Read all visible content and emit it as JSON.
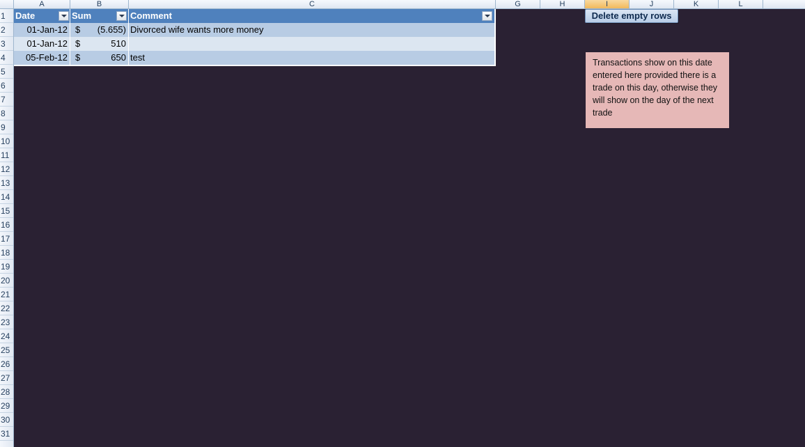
{
  "columns": [
    "A",
    "B",
    "C",
    "G",
    "H",
    "I",
    "J",
    "K",
    "L"
  ],
  "rows": [
    "1",
    "2",
    "3",
    "4",
    "5",
    "6",
    "7",
    "8",
    "9",
    "10",
    "11",
    "12",
    "13",
    "14",
    "15",
    "16",
    "17",
    "18",
    "19",
    "20",
    "21",
    "22",
    "23",
    "24",
    "25",
    "26",
    "27",
    "28",
    "29",
    "30",
    "31"
  ],
  "table": {
    "headers": {
      "date": "Date",
      "sum": "Sum",
      "comment": "Comment"
    },
    "records": [
      {
        "date": "01-Jan-12",
        "currency": "$",
        "sum": "(5.655)",
        "comment": "Divorced wife wants more money"
      },
      {
        "date": "01-Jan-12",
        "currency": "$",
        "sum": "510",
        "comment": ""
      },
      {
        "date": "05-Feb-12",
        "currency": "$",
        "sum": "650",
        "comment": "test"
      }
    ]
  },
  "button": {
    "label": "Delete empty rows"
  },
  "note": {
    "text": "Transactions show on this date entered here provided there is a trade on this day, otherwise they will show on the day of the next trade"
  },
  "colors": {
    "background": "#2a2133",
    "table_header": "#4f81bd",
    "band_dark": "#b8cce4",
    "band_light": "#dce6f1",
    "note": "#e6b8b7",
    "selected_column": "#f1b95c"
  }
}
